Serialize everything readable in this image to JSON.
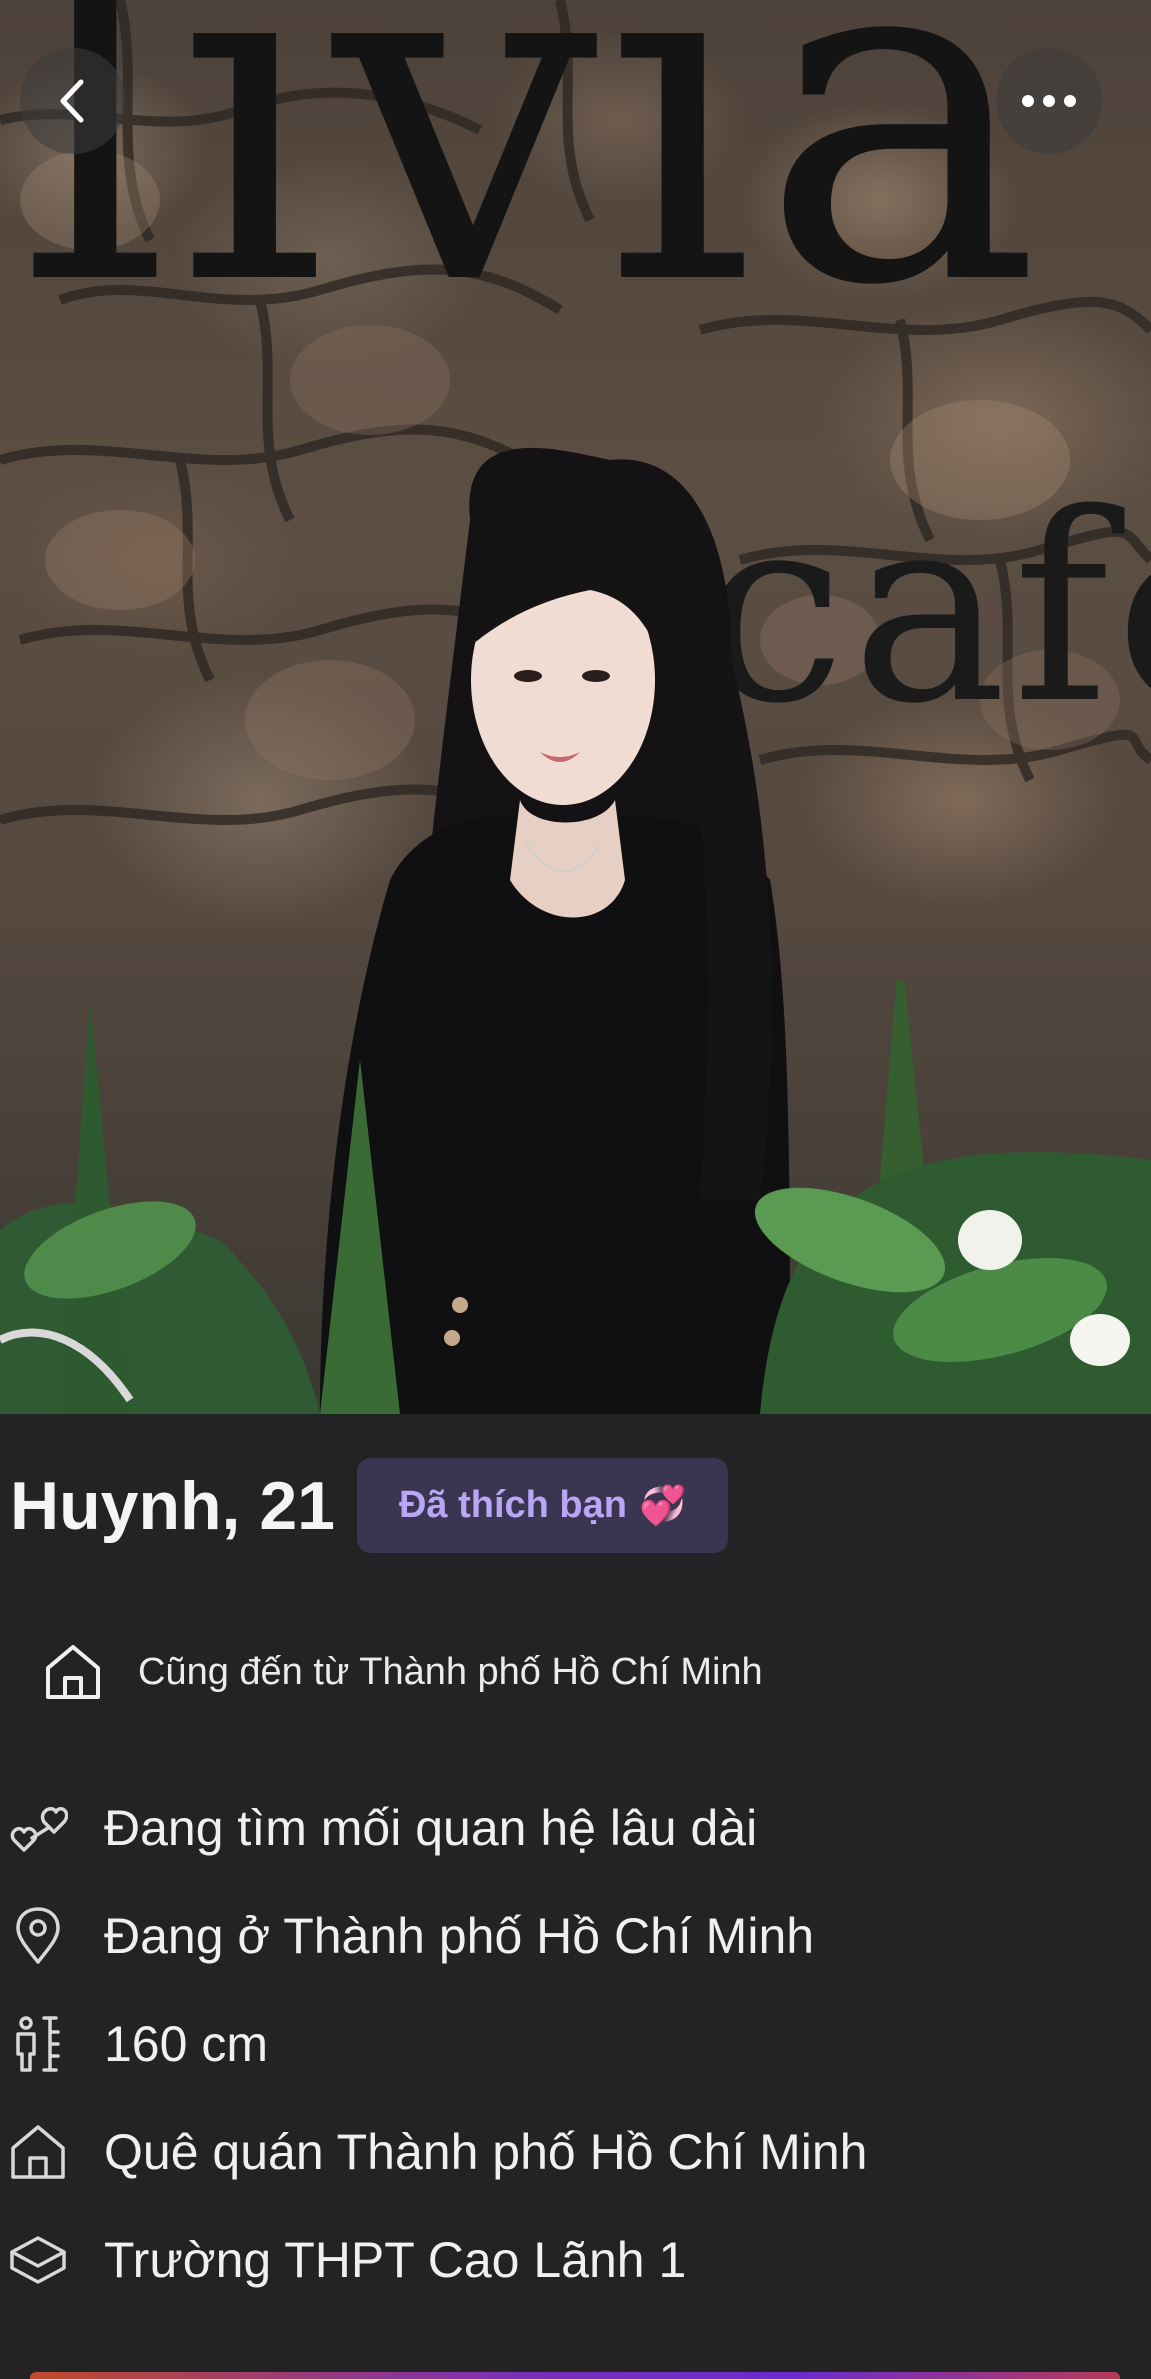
{
  "profile": {
    "name_age": "Huynh, 21",
    "liked_badge": "Đã thích bạn",
    "liked_emoji": "💞",
    "shared_hometown": "Cũng đến từ Thành phố Hồ Chí Minh"
  },
  "details": [
    {
      "icon": "hearts-icon",
      "text": "Đang tìm mối quan hệ lâu dài"
    },
    {
      "icon": "location-pin-icon",
      "text": "Đang ở Thành phố Hồ Chí Minh"
    },
    {
      "icon": "height-icon",
      "text": "160 cm"
    },
    {
      "icon": "home-icon",
      "text": "Quê quán Thành phố Hồ Chí Minh"
    },
    {
      "icon": "graduation-cap-icon",
      "text": "Trường THPT Cao Lãnh 1"
    }
  ],
  "photo": {
    "sign_line1": "livia",
    "sign_line2": "café"
  },
  "colors": {
    "background": "#232326",
    "badge_bg": "#3a3550",
    "badge_text": "#b9a6f5"
  }
}
